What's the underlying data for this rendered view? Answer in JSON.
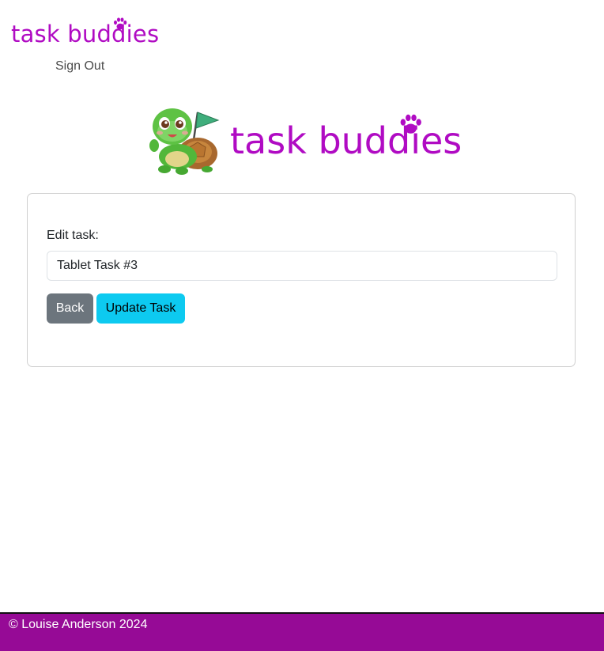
{
  "header": {
    "brand_text": "task buddies",
    "signout_label": "Sign Out"
  },
  "hero": {
    "title": "task buddies",
    "mascot_icon": "turtle-mascot-with-flag"
  },
  "form": {
    "label": "Edit task:",
    "task_value": "Tablet Task #3",
    "back_label": "Back",
    "update_label": "Update Task"
  },
  "footer": {
    "copyright": "© Louise Anderson 2024"
  },
  "colors": {
    "brand": "#b00bc3",
    "footer_bg": "#960a96",
    "back_button": "#6c757d",
    "update_button": "#0dcaf0"
  }
}
